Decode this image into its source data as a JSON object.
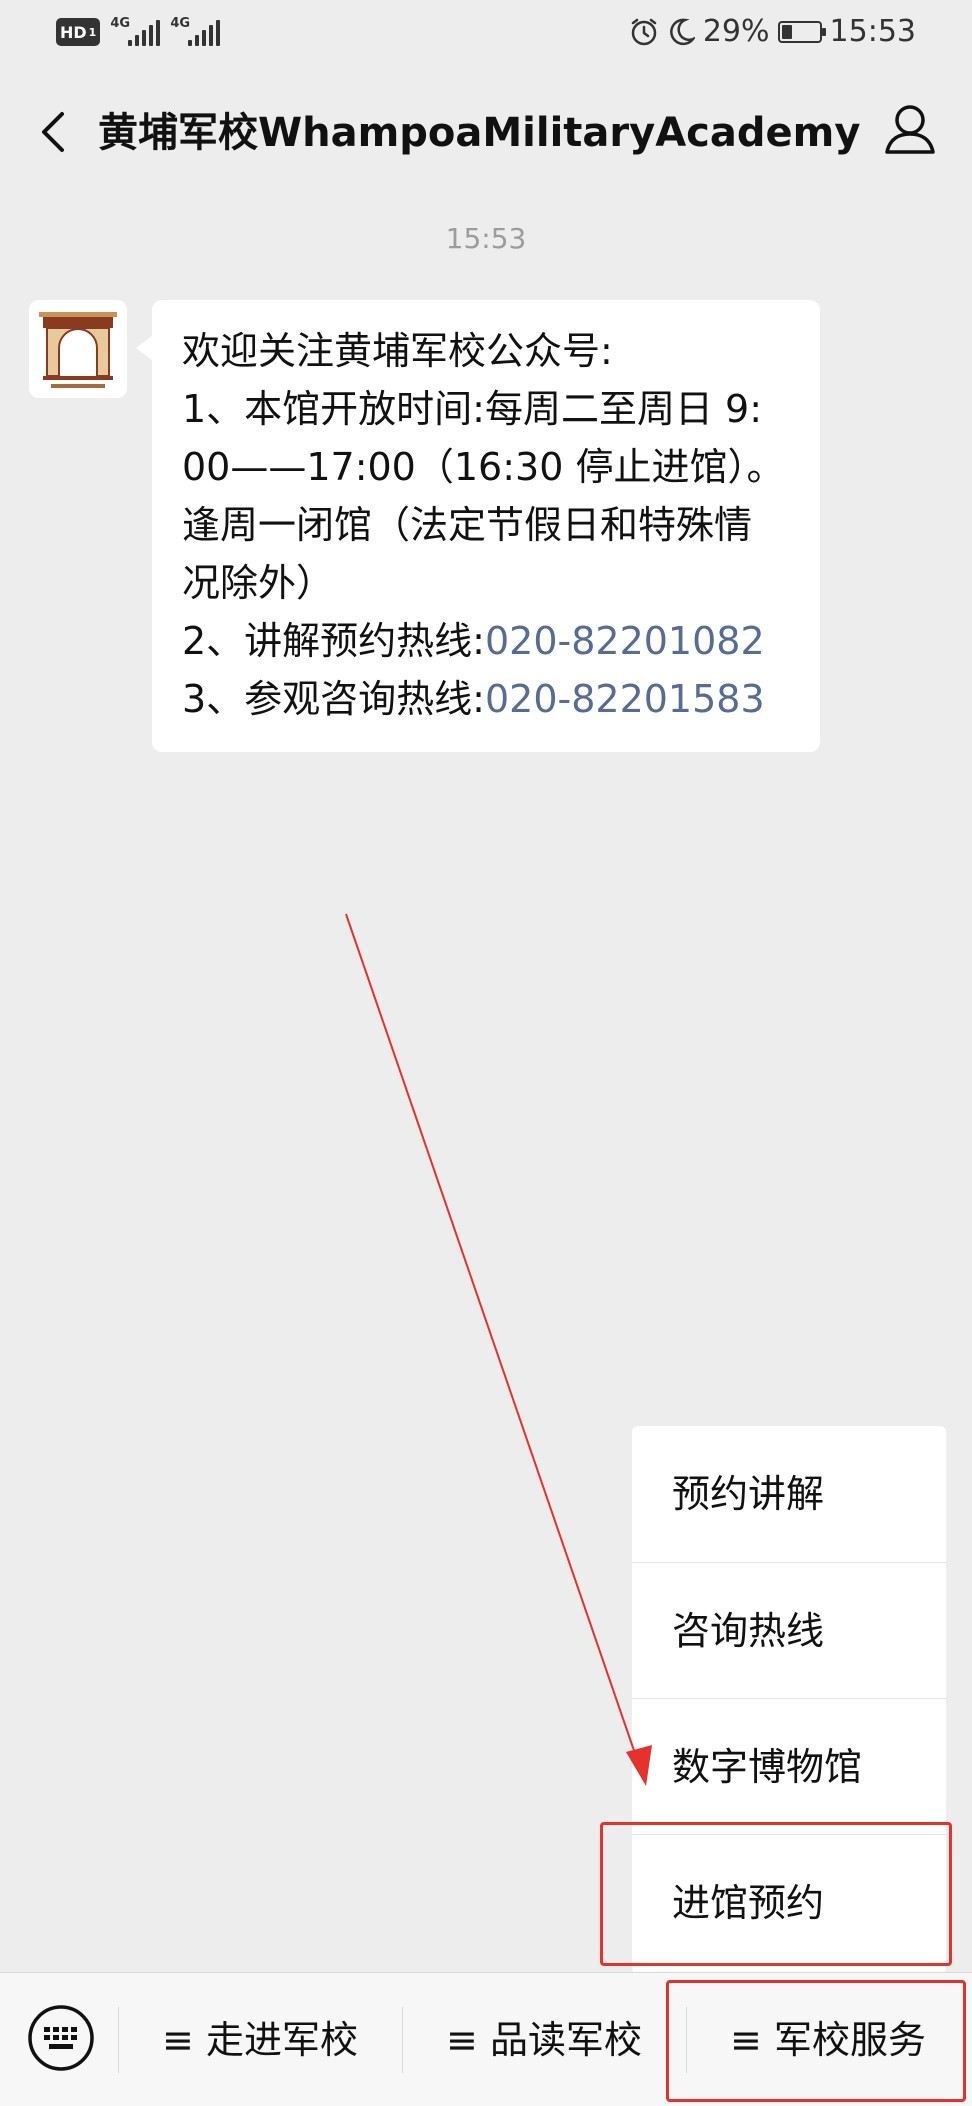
{
  "status_bar": {
    "hd": "HD",
    "hd_sub": "1",
    "network_1": "4G",
    "network_2": "4G",
    "battery": "29%",
    "battery_level": 0.29,
    "time": "15:53"
  },
  "title_bar": {
    "title": "黄埔军校WhampoaMilitaryAcademy"
  },
  "chat": {
    "timestamp": "15:53",
    "message": {
      "intro": "欢迎关注黄埔军校公众号:",
      "line1": "1、本馆开放时间:每周二至周日 9:",
      "line2": "00——17:00（16:30 停止进馆）。",
      "line3": "逢周一闭馆（法定节假日和特殊情",
      "line4": "况除外）",
      "hotline_label": "2、讲解预约热线:",
      "hotline_number": "020-82201082",
      "consult_label": "3、参观咨询热线:",
      "consult_number": "020-82201583"
    }
  },
  "popup_menu": {
    "items": [
      {
        "label": "预约讲解"
      },
      {
        "label": "咨询热线"
      },
      {
        "label": "数字博物馆"
      },
      {
        "label": "进馆预约"
      }
    ]
  },
  "bottom_menu": {
    "items": [
      {
        "label": "≡ 走进军校"
      },
      {
        "label": "≡ 品读军校"
      },
      {
        "label": "≡ 军校服务"
      }
    ]
  },
  "colors": {
    "background": "#ededed",
    "link": "#576b95",
    "annotation_red": "#e5322d"
  }
}
